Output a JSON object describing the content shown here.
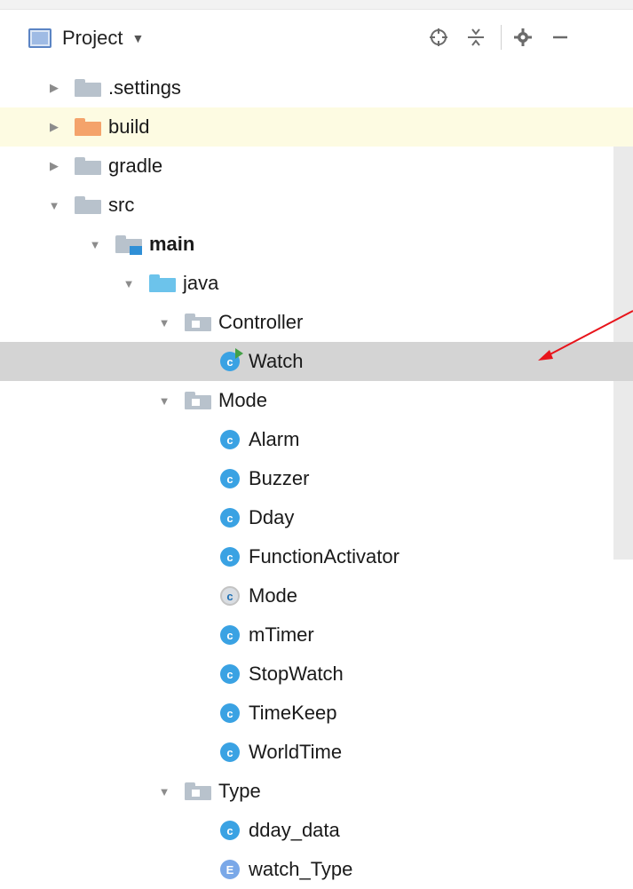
{
  "header": {
    "title": "Project",
    "dropdown_icon": "caret-down-icon",
    "actions": [
      "locate-icon",
      "collapse-all-icon",
      "gear-icon",
      "minimize-icon"
    ]
  },
  "tree": [
    {
      "label": ".settings",
      "kind": "folder-grey",
      "expanded": false
    },
    {
      "label": "build",
      "kind": "folder-orange",
      "expanded": false
    },
    {
      "label": "gradle",
      "kind": "folder-grey",
      "expanded": false
    },
    {
      "label": "src",
      "kind": "folder-grey",
      "expanded": true
    },
    {
      "label": "main",
      "kind": "folder-module",
      "expanded": true
    },
    {
      "label": "java",
      "kind": "folder-source",
      "expanded": true
    },
    {
      "label": "Controller",
      "kind": "package",
      "expanded": true
    },
    {
      "label": "Watch",
      "kind": "class-runnable",
      "selected": true
    },
    {
      "label": "Mode",
      "kind": "package",
      "expanded": true
    },
    {
      "label": "Alarm",
      "kind": "class"
    },
    {
      "label": "Buzzer",
      "kind": "class"
    },
    {
      "label": "Dday",
      "kind": "class"
    },
    {
      "label": "FunctionActivator",
      "kind": "class"
    },
    {
      "label": "Mode",
      "kind": "class-abstract"
    },
    {
      "label": "mTimer",
      "kind": "class"
    },
    {
      "label": "StopWatch",
      "kind": "class"
    },
    {
      "label": "TimeKeep",
      "kind": "class"
    },
    {
      "label": "WorldTime",
      "kind": "class"
    },
    {
      "label": "Type",
      "kind": "package",
      "expanded": true
    },
    {
      "label": "dday_data",
      "kind": "class"
    },
    {
      "label": "watch_Type",
      "kind": "enum"
    }
  ],
  "icon_letters": {
    "class": "c",
    "enum": "E"
  },
  "colors": {
    "selection": "#d4d4d4",
    "build_row": "#fdfbe2",
    "annotation_arrow": "#e8141b"
  }
}
